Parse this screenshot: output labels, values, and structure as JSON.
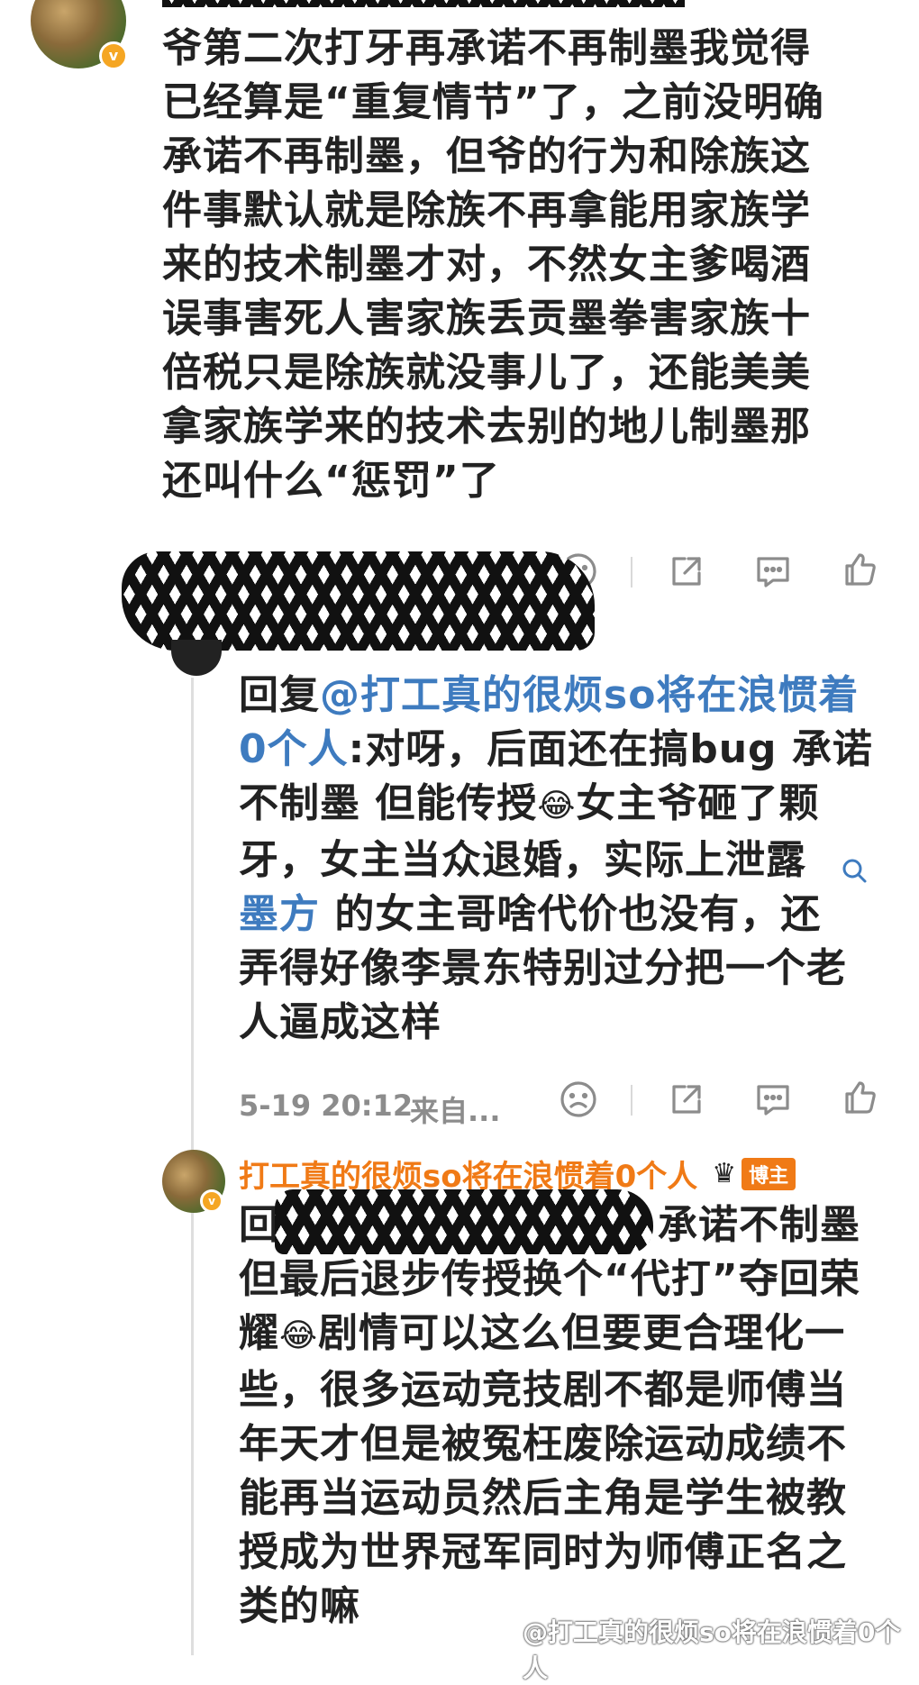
{
  "comment1": {
    "text_lines": [
      "爷第二次打牙再承诺不再制墨我觉得",
      "已经算是“重复情节”了，之前没明确",
      "承诺不再制墨，但爷的行为和除族这",
      "件事默认就是除族不再拿能用家族学",
      "来的技术制墨才对，不然女主爹喝酒",
      "误事害死人害家族丢贡墨拳害家族十",
      "倍税只是除族就没事儿了，还能美美",
      "拿家族学来的技术去别的地儿制墨那",
      "还叫什么“惩罚”了"
    ],
    "verified_badge": "v"
  },
  "reply1": {
    "prefix": "回复",
    "mention_line1": "@打工真的很烦so将在浪惯着",
    "mention_line2": "0个人",
    "line2_rest": ":对呀，后面还在搞bug 承诺",
    "line3a": "不制墨 但能传授",
    "line3b": "女主爷砸了颗",
    "line4": "牙，女主当众退婚，实际上泄露",
    "link_word": "墨方",
    "line5_rest": " 的女主哥啥代价也没有，还",
    "line6": "弄得好像李景东特别过分把一个老",
    "line7": "人逼成这样",
    "timestamp": "5-19 20:12",
    "source": "来自..."
  },
  "reply2": {
    "author": "打工真的很烦so将在浪惯着0个人",
    "tag": "博主",
    "crown_icon": "♛",
    "line1_start": "回",
    "line1_end": "承诺不制墨",
    "line2": "但最后退步传授换个“代打”夺回荣",
    "line3a": "耀",
    "line3b": "剧情可以这么但要更合理化一",
    "line4": "些，很多运动竞技剧不都是师傅当",
    "line5": "年天才但是被冤枉废除运动成绩不",
    "line6": "能再当运动员然后主角是学生被教",
    "line7": "授成为世界冠军同时为师傅正名之",
    "line8": "类的嘛"
  },
  "watermark": "@打工真的很烦so将在浪惯着0个人",
  "emoji": "😂",
  "colors": {
    "link": "#3e7bbf",
    "orange": "#f07a16",
    "meta": "#8c8c8c"
  }
}
